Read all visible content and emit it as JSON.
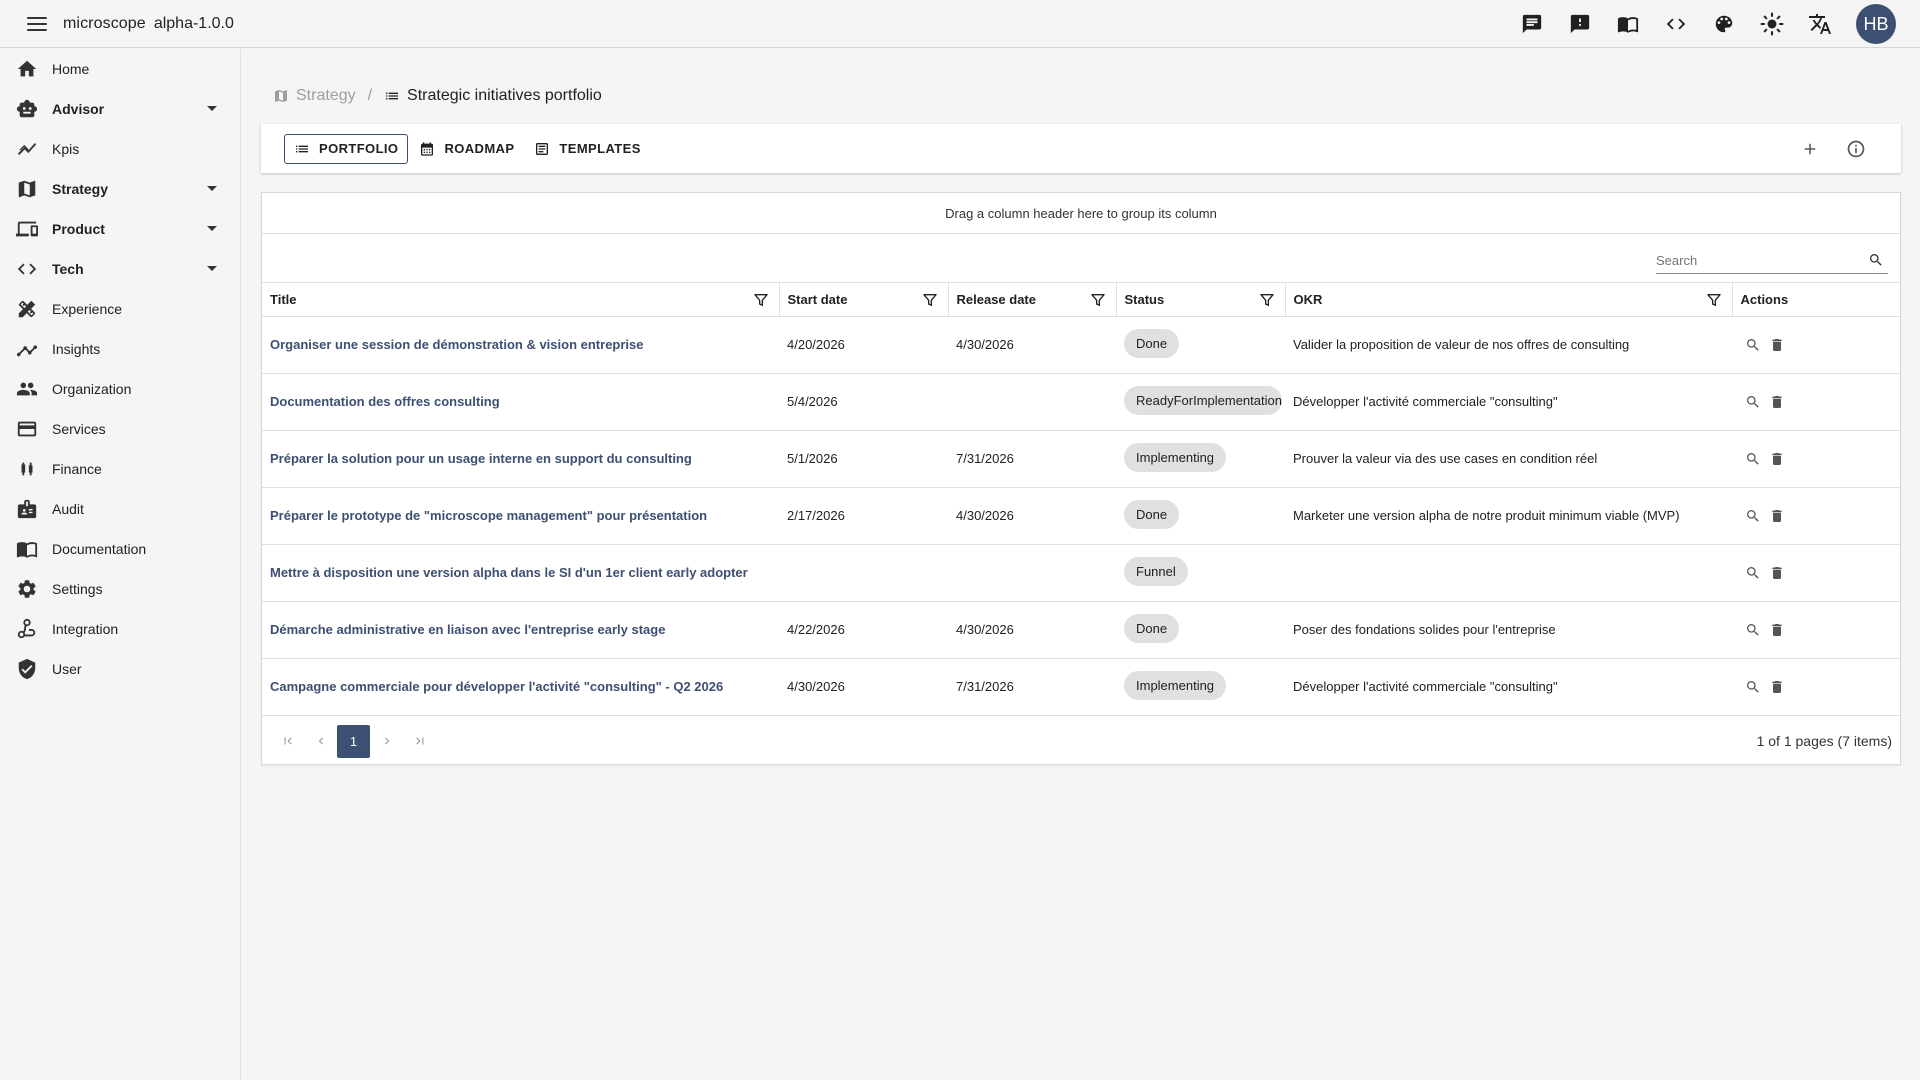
{
  "app": {
    "name": "microscope",
    "version": "alpha-1.0.0"
  },
  "user": {
    "initials": "HB"
  },
  "colors": {
    "accent": "#3d4f72",
    "chip": "#e0e0e0",
    "background": "#f5f5f5"
  },
  "topbar_icons": [
    "chat-icon",
    "feedback-icon",
    "docs-book-icon",
    "code-icon",
    "palette-icon",
    "brightness-icon",
    "translate-icon"
  ],
  "sidebar": {
    "items": [
      {
        "label": "Home",
        "icon": "home-icon",
        "expandable": false
      },
      {
        "label": "Advisor",
        "icon": "robot-icon",
        "expandable": true
      },
      {
        "label": "Kpis",
        "icon": "chart-line-icon",
        "expandable": false
      },
      {
        "label": "Strategy",
        "icon": "map-icon",
        "expandable": true
      },
      {
        "label": "Product",
        "icon": "devices-icon",
        "expandable": true
      },
      {
        "label": "Tech",
        "icon": "code-icon",
        "expandable": true
      },
      {
        "label": "Experience",
        "icon": "design-tools-icon",
        "expandable": false
      },
      {
        "label": "Insights",
        "icon": "trending-icon",
        "expandable": false
      },
      {
        "label": "Organization",
        "icon": "people-icon",
        "expandable": false
      },
      {
        "label": "Services",
        "icon": "services-icon",
        "expandable": false
      },
      {
        "label": "Finance",
        "icon": "finance-icon",
        "expandable": false
      },
      {
        "label": "Audit",
        "icon": "audit-icon",
        "expandable": false
      },
      {
        "label": "Documentation",
        "icon": "book-icon",
        "expandable": false
      },
      {
        "label": "Settings",
        "icon": "gear-icon",
        "expandable": false
      },
      {
        "label": "Integration",
        "icon": "integration-icon",
        "expandable": false
      },
      {
        "label": "User",
        "icon": "shield-icon",
        "expandable": false
      }
    ]
  },
  "breadcrumb": {
    "parent": "Strategy",
    "current": "Strategic initiatives portfolio"
  },
  "tabs": [
    {
      "label": "PORTFOLIO",
      "icon": "list-icon",
      "active": true
    },
    {
      "label": "ROADMAP",
      "icon": "calendar-icon",
      "active": false
    },
    {
      "label": "TEMPLATES",
      "icon": "template-icon",
      "active": false
    }
  ],
  "grid": {
    "group_panel_text": "Drag a column header here to group its column",
    "search_placeholder": "Search",
    "columns": [
      "Title",
      "Start date",
      "Release date",
      "Status",
      "OKR",
      "Actions"
    ],
    "rows": [
      {
        "title": "Organiser une session de démonstration & vision entreprise",
        "start": "4/20/2026",
        "release": "4/30/2026",
        "status": "Done",
        "okr": "Valider la proposition de valeur de nos offres de consulting"
      },
      {
        "title": "Documentation des offres consulting",
        "start": "5/4/2026",
        "release": "",
        "status": "ReadyForImplementation",
        "okr": "Développer l'activité commerciale \"consulting\""
      },
      {
        "title": "Préparer la solution pour un usage interne en support du consulting",
        "start": "5/1/2026",
        "release": "7/31/2026",
        "status": "Implementing",
        "okr": "Prouver la valeur via des use cases en condition réel"
      },
      {
        "title": "Préparer le prototype de \"microscope management\" pour présentation",
        "start": "2/17/2026",
        "release": "4/30/2026",
        "status": "Done",
        "okr": "Marketer une version alpha de notre produit minimum viable (MVP)"
      },
      {
        "title": "Mettre à disposition une version alpha dans le SI d'un 1er client early adopter",
        "start": "",
        "release": "",
        "status": "Funnel",
        "okr": ""
      },
      {
        "title": "Démarche administrative en liaison avec l'entreprise early stage",
        "start": "4/22/2026",
        "release": "4/30/2026",
        "status": "Done",
        "okr": "Poser des fondations solides pour l'entreprise"
      },
      {
        "title": "Campagne commerciale pour développer l'activité \"consulting\" - Q2 2026",
        "start": "4/30/2026",
        "release": "7/31/2026",
        "status": "Implementing",
        "okr": "Développer l'activité commerciale \"consulting\""
      }
    ],
    "pager": {
      "current_page": "1",
      "info": "1 of 1 pages (7 items)"
    }
  }
}
